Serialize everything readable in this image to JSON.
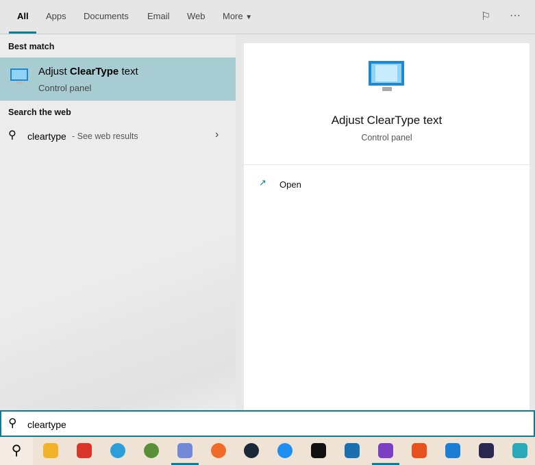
{
  "tabs": [
    {
      "label": "All"
    },
    {
      "label": "Apps"
    },
    {
      "label": "Documents"
    },
    {
      "label": "Email"
    },
    {
      "label": "Web"
    },
    {
      "label": "More"
    }
  ],
  "header_icons": [
    "feedback-icon",
    "more-options-icon"
  ],
  "best_match": {
    "heading": "Best match",
    "title_pre": "Adjust ",
    "title_bold": "ClearType",
    "title_post": " text",
    "subtitle": "Control panel"
  },
  "web": {
    "heading": "Search the web",
    "query": "cleartype",
    "suffix": " - See web results"
  },
  "detail": {
    "title": "Adjust ClearType text",
    "subtitle": "Control panel",
    "action": "Open"
  },
  "search": {
    "value": "cleartype"
  },
  "taskbar": {
    "apps": [
      {
        "name": "file-explorer",
        "color": "#f2b32a"
      },
      {
        "name": "ccleaner",
        "color": "#d9352a"
      },
      {
        "name": "telegram",
        "color": "#2a9fd8"
      },
      {
        "name": "xbox-app",
        "color": "#5a8f3a"
      },
      {
        "name": "discord",
        "color": "#7289da"
      },
      {
        "name": "origin",
        "color": "#f06a2a"
      },
      {
        "name": "steam",
        "color": "#1b2838"
      },
      {
        "name": "uplay",
        "color": "#1e8ef0"
      },
      {
        "name": "epic-games",
        "color": "#111111"
      },
      {
        "name": "app-hexagon",
        "color": "#1a6fb0"
      },
      {
        "name": "brave-nightly",
        "color": "#7b3fc4"
      },
      {
        "name": "app-orange",
        "color": "#e8501e"
      },
      {
        "name": "vscode",
        "color": "#1a7fd4"
      },
      {
        "name": "app-s",
        "color": "#2a2850"
      },
      {
        "name": "app-teal",
        "color": "#2aa9b8"
      }
    ]
  },
  "accent": "#0f7b8f"
}
